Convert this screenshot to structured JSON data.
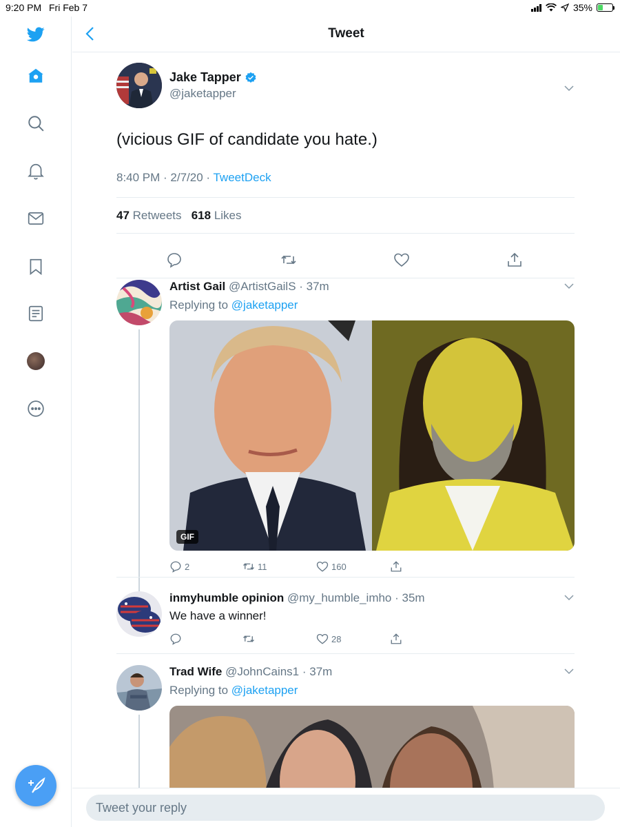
{
  "status_bar": {
    "time": "9:20 PM",
    "date": "Fri Feb 7",
    "battery": "35%",
    "battery_level": 0.35
  },
  "header": {
    "title": "Tweet"
  },
  "sidebar": {
    "items": [
      {
        "icon": "twitter-logo-icon"
      },
      {
        "icon": "home-icon"
      },
      {
        "icon": "search-icon"
      },
      {
        "icon": "bell-icon"
      },
      {
        "icon": "mail-icon"
      },
      {
        "icon": "bookmark-icon"
      },
      {
        "icon": "list-icon"
      },
      {
        "icon": "profile-avatar"
      },
      {
        "icon": "more-icon"
      }
    ],
    "compose_icon": "compose-tweet-icon"
  },
  "main_tweet": {
    "name": "Jake Tapper",
    "handle": "@jaketapper",
    "text": "(vicious GIF of candidate you hate.)",
    "time": "8:40 PM · 2/7/20 · ",
    "source": "TweetDeck",
    "retweets": "47",
    "retweets_label": "Retweets",
    "likes": "618",
    "likes_label": "Likes"
  },
  "replies": [
    {
      "name": "Artist Gail",
      "handle_time": "@ArtistGailS · 37m",
      "replying_prefix": "Replying to ",
      "replying_to": "@jaketapper",
      "media_badge": "GIF",
      "reply_count": "2",
      "retweet_count": "11",
      "like_count": "160"
    },
    {
      "name": "inmyhumble opinion",
      "handle_time": "@my_humble_imho · 35m",
      "text": "We have a winner!",
      "reply_count": "",
      "retweet_count": "",
      "like_count": "28"
    },
    {
      "name": "Trad Wife",
      "handle_time": "@JohnCains1 · 37m",
      "replying_prefix": "Replying to ",
      "replying_to": "@jaketapper"
    }
  ],
  "reply_bar": {
    "placeholder": "Tweet your reply"
  },
  "colors": {
    "accent": "#1da1f2",
    "muted": "#657786",
    "divider": "#e6ecf0",
    "fab": "#4a9ff5"
  }
}
